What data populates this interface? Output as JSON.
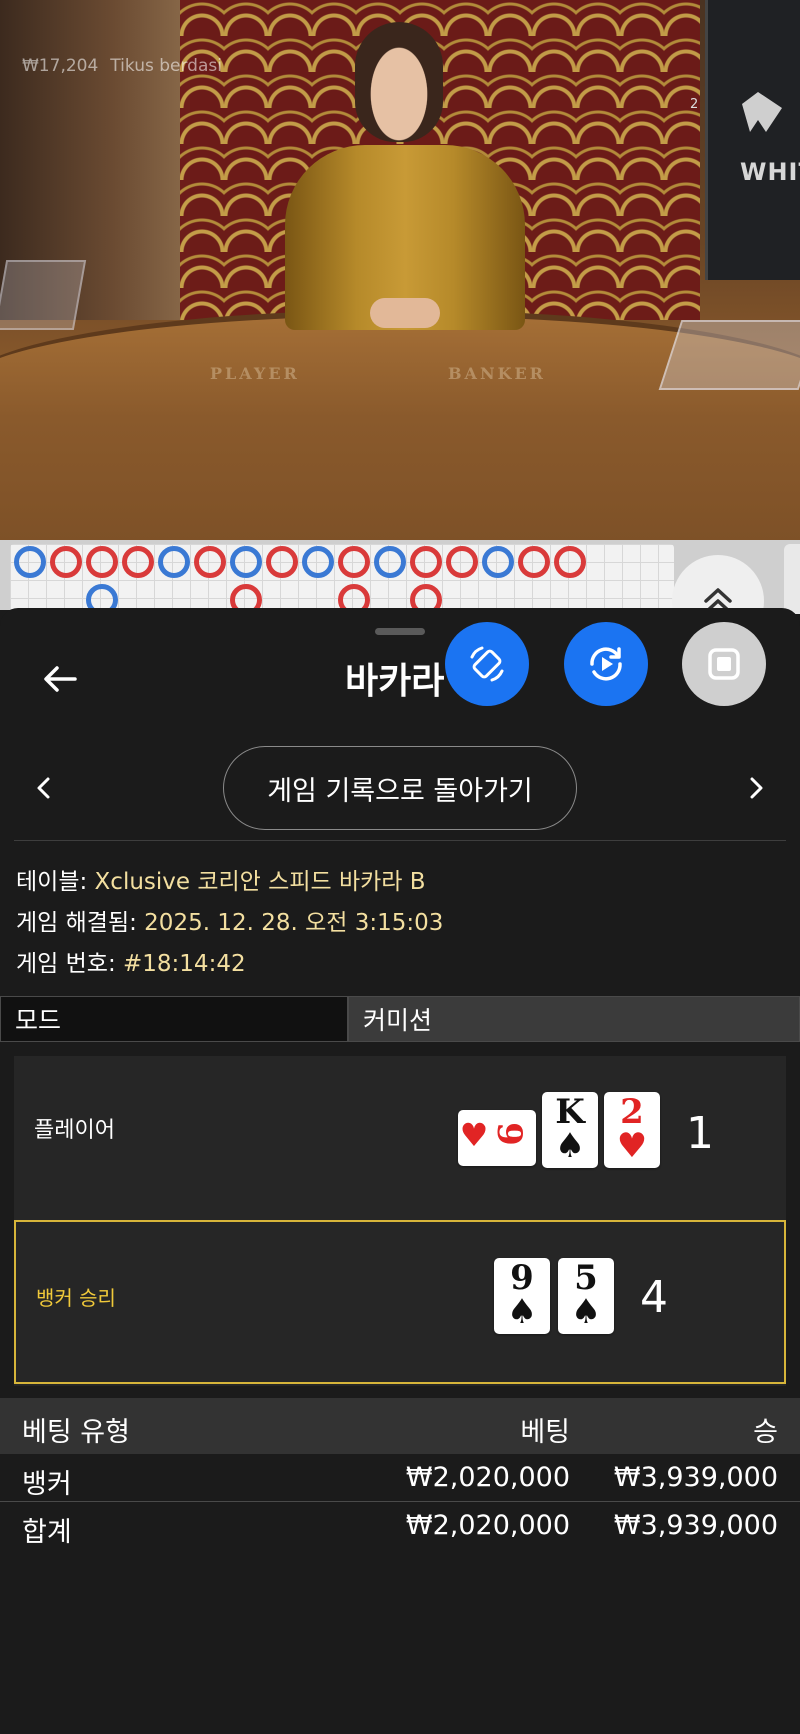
{
  "video": {
    "ticker_amount": "₩17,204",
    "ticker_name": "Tikus berdasi",
    "table_left_label": "PLAYER",
    "table_right_label": "BANKER",
    "monitor_logo": "WHITE",
    "monitor_counter": "2"
  },
  "road": {
    "top_row": [
      "blue",
      "red",
      "red",
      "red",
      "blue",
      "red",
      "blue",
      "red",
      "blue",
      "red",
      "blue",
      "red",
      "red",
      "blue",
      "red",
      "red"
    ],
    "second_row": [
      "blue",
      "red",
      "red",
      "red"
    ]
  },
  "sheet": {
    "title": "바카라",
    "back_icon": "arrow-left-icon",
    "fab_icons": [
      "rotate-phone-icon",
      "replay-icon",
      "stop-icon"
    ],
    "colors": {
      "fab_blue": "#1b74f2",
      "fab_gray": "#cfcfcf",
      "win_accent": "#f0c93a",
      "value_color": "#f3dfa0"
    }
  },
  "nav": {
    "back_to_history": "게임 기록으로 돌아가기",
    "prev_icon": "chevron-left-icon",
    "next_icon": "chevron-right-icon"
  },
  "info": {
    "table_label": "테이블: ",
    "table_value": "Xclusive 코리안 스피드 바카라 B",
    "resolved_label": "게임 해결됨: ",
    "resolved_value": "2025. 12. 28. 오전 3:15:03",
    "number_label": "게임 번호: ",
    "number_value": "#18:14:42"
  },
  "tabs": {
    "mode": "모드",
    "commission": "커미션"
  },
  "result": {
    "player_label": "플레이어",
    "player_score": "1",
    "player_cards": [
      {
        "rank": "9",
        "suit": "♥",
        "color": "red",
        "rotated": true
      },
      {
        "rank": "K",
        "suit": "♠",
        "color": "black"
      },
      {
        "rank": "2",
        "suit": "♥",
        "color": "red"
      }
    ],
    "banker_label": "뱅커 승리",
    "banker_score": "4",
    "banker_cards": [
      {
        "rank": "9",
        "suit": "♠",
        "color": "black"
      },
      {
        "rank": "5",
        "suit": "♠",
        "color": "black"
      }
    ]
  },
  "bets": {
    "headers": {
      "type": "베팅 유형",
      "bet": "베팅",
      "win": "승"
    },
    "rows": [
      {
        "type": "뱅커",
        "bet": "₩2,020,000",
        "win": "₩3,939,000"
      }
    ],
    "total": {
      "type": "합계",
      "bet": "₩2,020,000",
      "win": "₩3,939,000"
    }
  }
}
